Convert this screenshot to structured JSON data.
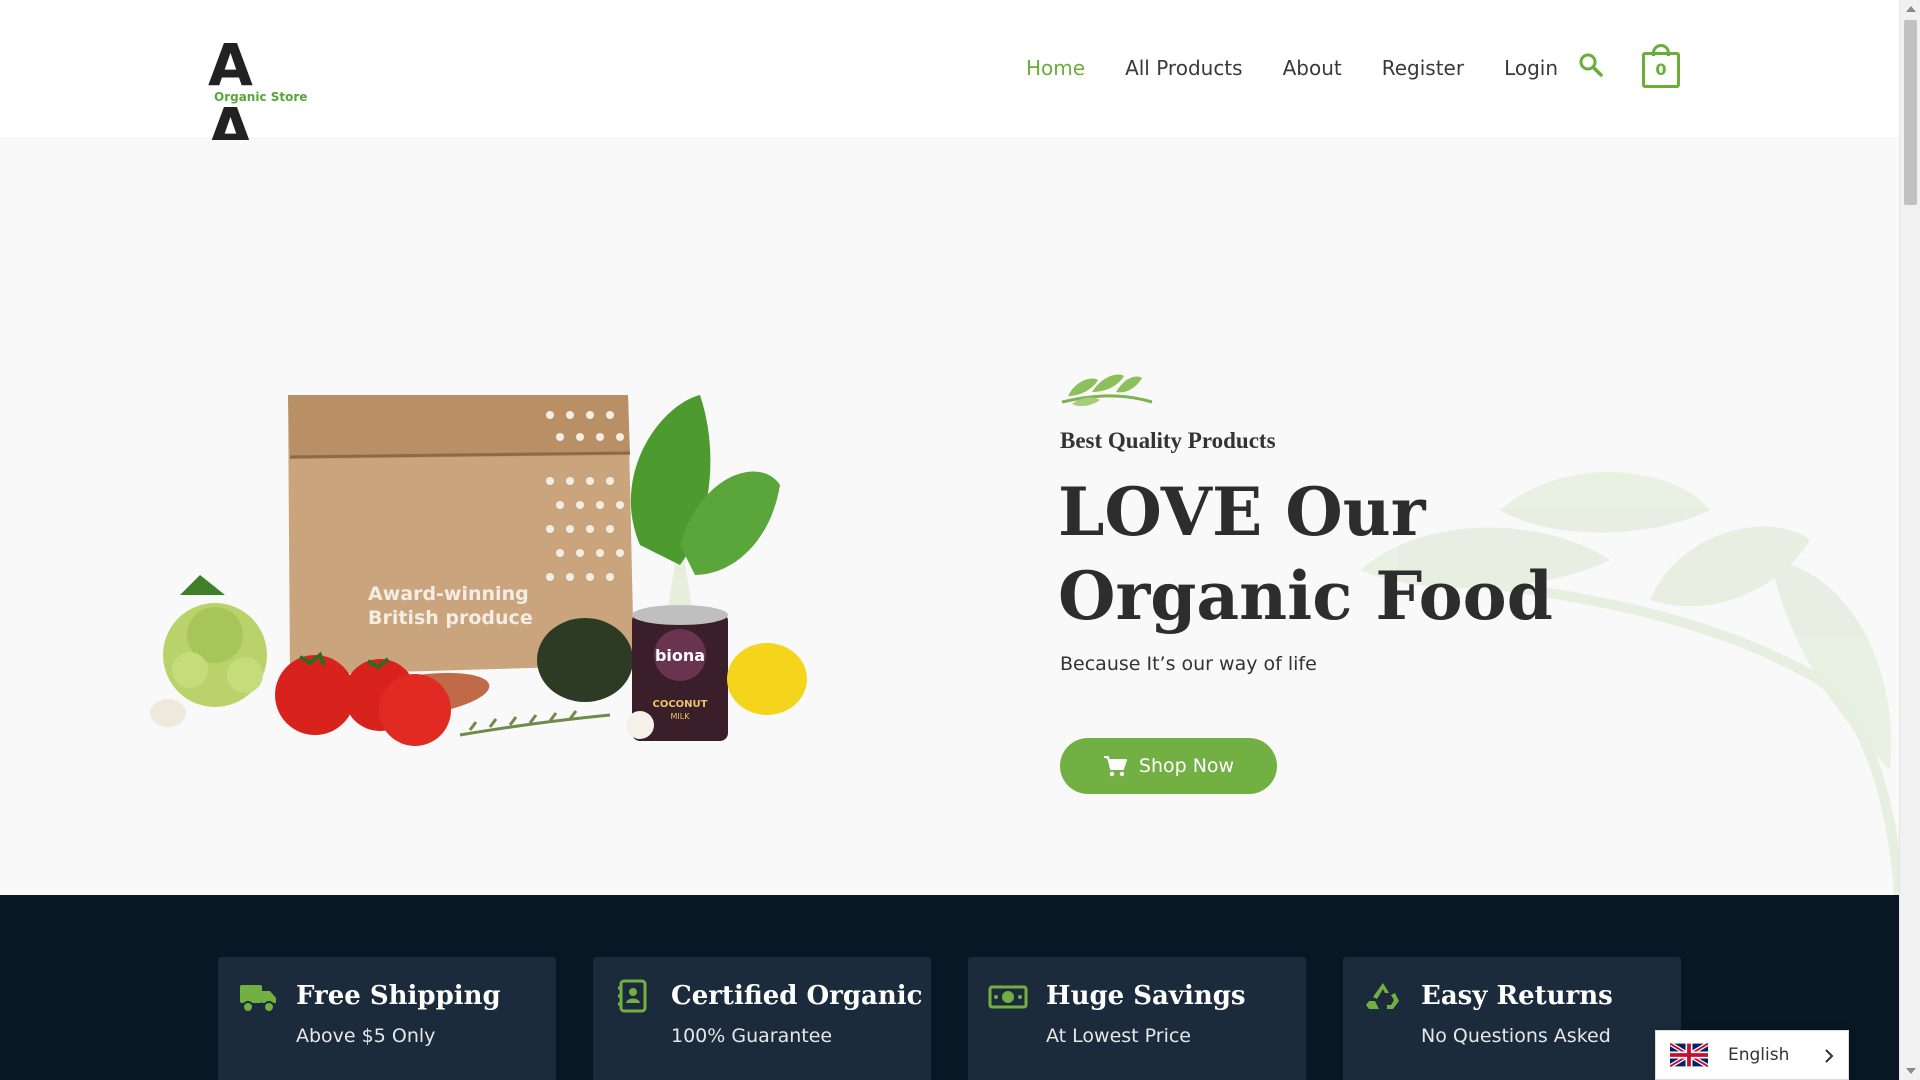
{
  "logo": {
    "letters": "A A",
    "subtitle": "Organic Store"
  },
  "nav": {
    "items": [
      {
        "label": "Home",
        "active": true
      },
      {
        "label": "All Products",
        "active": false
      },
      {
        "label": "About",
        "active": false
      },
      {
        "label": "Register",
        "active": false
      },
      {
        "label": "Login",
        "active": false
      }
    ],
    "search_icon": "search-icon",
    "cart_count": "0"
  },
  "hero": {
    "tagline": "Best Quality Products",
    "headline": "LOVE Our Organic Food",
    "subline": "Because It’s our way of life",
    "button_label": "Shop Now",
    "bag_text_line1": "Award-winning",
    "bag_text_line2": "British produce",
    "can_brand": "biona",
    "can_label": "COCONUT",
    "can_sublabel": "MILK"
  },
  "features": [
    {
      "icon": "truck-icon",
      "title": "Free Shipping",
      "subtitle": "Above $5 Only"
    },
    {
      "icon": "certificate-icon",
      "title": "Certified Organic",
      "subtitle": "100% Guarantee"
    },
    {
      "icon": "money-icon",
      "title": "Huge Savings",
      "subtitle": "At Lowest Price"
    },
    {
      "icon": "recycle-icon",
      "title": "Easy Returns",
      "subtitle": "No Questions Asked"
    }
  ],
  "language": {
    "label": "English",
    "flag": "uk-flag-icon"
  },
  "colors": {
    "accent": "#72b043",
    "dark": "#091624",
    "card": "#1c2b3b"
  }
}
